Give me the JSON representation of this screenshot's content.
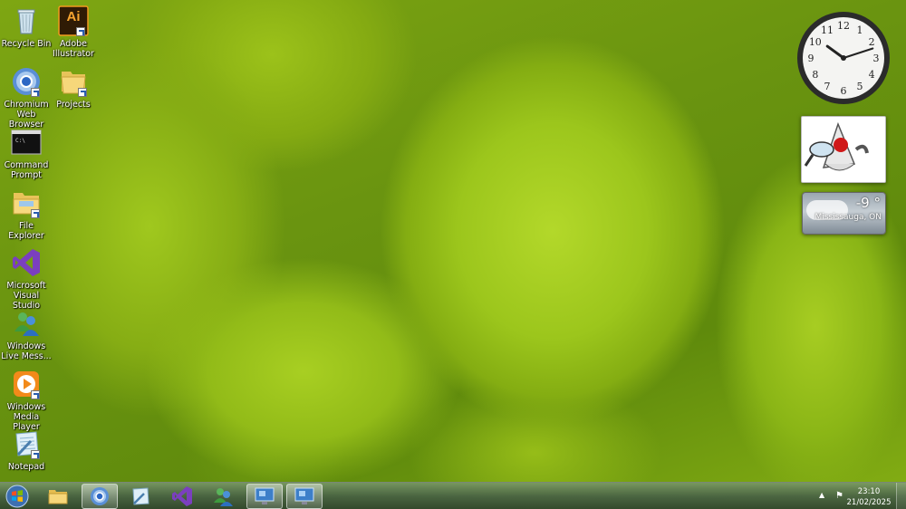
{
  "desktop_icons": [
    {
      "id": "recycle-bin",
      "label": "Recycle Bin",
      "icon": "recycle-bin-icon"
    },
    {
      "id": "adobe-illustrator",
      "label": "Adobe Illustrator",
      "icon": "adobe-illustrator-icon",
      "glyph": "Ai"
    },
    {
      "id": "chromium",
      "label": "Chromium Web Browser",
      "icon": "chromium-icon"
    },
    {
      "id": "projects",
      "label": "Projects",
      "icon": "folder-icon"
    },
    {
      "id": "command-prompt",
      "label": "Command Prompt",
      "icon": "command-prompt-icon",
      "glyph": "C:\\"
    },
    {
      "id": "file-explorer",
      "label": "File Explorer",
      "icon": "file-explorer-icon"
    },
    {
      "id": "visual-studio",
      "label": "Microsoft Visual Studio",
      "icon": "visual-studio-icon"
    },
    {
      "id": "live-messenger",
      "label": "Windows Live Mess...",
      "icon": "messenger-icon"
    },
    {
      "id": "media-player",
      "label": "Windows Media Player",
      "icon": "media-player-icon"
    },
    {
      "id": "notepad",
      "label": "Notepad",
      "icon": "notepad-icon"
    }
  ],
  "gadgets": {
    "clock": {
      "time_shown": "10:12",
      "numerals": [
        "12",
        "1",
        "2",
        "3",
        "4",
        "5",
        "6",
        "7",
        "8",
        "9",
        "10",
        "11"
      ]
    },
    "weather": {
      "temperature": "-9 °",
      "location": "Mississauga, ON"
    },
    "mascot": {
      "icon": "duke-mascot-icon"
    }
  },
  "taskbar": {
    "start_icon": "windows-start-icon",
    "buttons": [
      {
        "id": "explorer",
        "icon": "folder-icon",
        "active": false
      },
      {
        "id": "chromium",
        "icon": "chromium-icon",
        "active": true
      },
      {
        "id": "notepad",
        "icon": "notepad-icon",
        "active": false
      },
      {
        "id": "visual-studio",
        "icon": "visual-studio-icon",
        "active": false
      },
      {
        "id": "messenger",
        "icon": "messenger-icon",
        "active": false
      },
      {
        "id": "remote-1",
        "icon": "remote-desktop-icon",
        "active": true
      },
      {
        "id": "remote-2",
        "icon": "remote-desktop-icon",
        "active": true
      }
    ],
    "tray": {
      "time": "23:10",
      "date": "21/02/2025",
      "arrow_glyph": "▲",
      "flag_glyph": "⚑"
    }
  },
  "colors": {
    "wallpaper_accent": "#9cc61c",
    "taskbar": "#465f46"
  }
}
